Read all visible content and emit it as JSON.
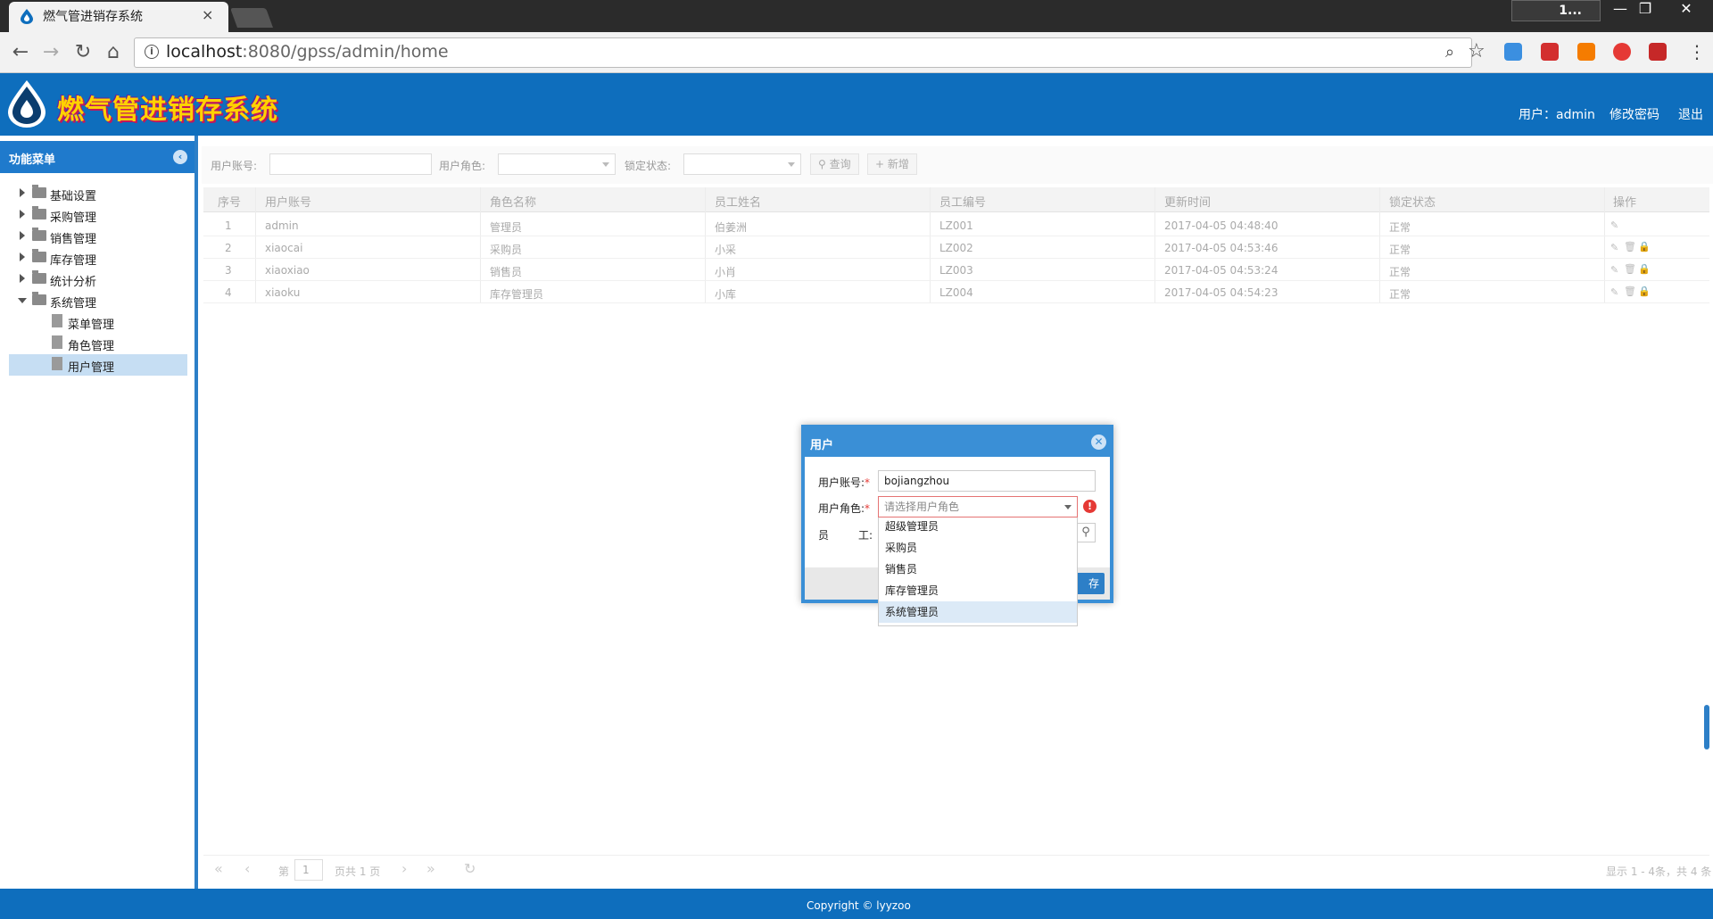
{
  "browser": {
    "tab_title": "燃气管进销存系统",
    "tab_close": "×",
    "window_user": "1...",
    "window_buttons": {
      "minimize": "—",
      "restore": "❐",
      "close": "✕"
    },
    "nav": {
      "back": "←",
      "forward": "→",
      "reload": "↻",
      "home": "⌂"
    },
    "url_host": "localhost",
    "url_path": ":8080/gpss/admin/home",
    "zoom_icon": "⌕",
    "star_icon": "☆",
    "menu_dots": "⋮",
    "extension_colors": [
      "#3b8fe0",
      "#d32f2f",
      "#f57c00",
      "#e53935",
      "#c62828"
    ]
  },
  "header": {
    "app_title": "燃气管进销存系统",
    "user_label": "用户：admin",
    "change_password": "修改密码",
    "logout": "退出"
  },
  "sidebar": {
    "title": "功能菜单",
    "collapse_icon": "‹",
    "items": [
      {
        "label": "基础设置",
        "type": "folder",
        "expanded": false
      },
      {
        "label": "采购管理",
        "type": "folder",
        "expanded": false
      },
      {
        "label": "销售管理",
        "type": "folder",
        "expanded": false
      },
      {
        "label": "库存管理",
        "type": "folder",
        "expanded": false
      },
      {
        "label": "统计分析",
        "type": "folder",
        "expanded": false
      },
      {
        "label": "系统管理",
        "type": "folder",
        "expanded": true
      },
      {
        "label": "菜单管理",
        "type": "file"
      },
      {
        "label": "角色管理",
        "type": "file"
      },
      {
        "label": "用户管理",
        "type": "file",
        "selected": true
      }
    ]
  },
  "filters": {
    "account_label": "用户账号:",
    "role_label": "用户角色:",
    "lock_label": "锁定状态:",
    "search_button": "查询",
    "add_button": "新增",
    "search_icon": "⚲",
    "add_icon": "+"
  },
  "grid": {
    "columns": [
      "序号",
      "用户账号",
      "角色名称",
      "员工姓名",
      "员工编号",
      "更新时间",
      "锁定状态",
      "操作"
    ],
    "rows": [
      {
        "no": "1",
        "account": "admin",
        "role": "管理员",
        "name": "伯姜洲",
        "emp_no": "LZ001",
        "updated": "2017-04-05 04:48:40",
        "status": "正常"
      },
      {
        "no": "2",
        "account": "xiaocai",
        "role": "采购员",
        "name": "小采",
        "emp_no": "LZ002",
        "updated": "2017-04-05 04:53:46",
        "status": "正常"
      },
      {
        "no": "3",
        "account": "xiaoxiao",
        "role": "销售员",
        "name": "小肖",
        "emp_no": "LZ003",
        "updated": "2017-04-05 04:53:24",
        "status": "正常"
      },
      {
        "no": "4",
        "account": "xiaoku",
        "role": "库存管理员",
        "name": "小库",
        "emp_no": "LZ004",
        "updated": "2017-04-05 04:54:23",
        "status": "正常"
      }
    ],
    "op_icons": {
      "edit": "✎",
      "delete": "🗑",
      "lock": "🔒"
    }
  },
  "pager": {
    "first": "«",
    "prev": "‹",
    "page_prefix": "第",
    "page_value": "1",
    "page_suffix": "页共 1 页",
    "next": "›",
    "last": "»",
    "refresh": "↻",
    "info": "显示 1 - 4条，共 4 条"
  },
  "dialog": {
    "title": "用户",
    "close_icon": "✕",
    "account_label": "用户账号:",
    "account_value": "bojiangzhou",
    "role_label": "用户角色:",
    "role_placeholder": "请选择用户角色",
    "required_mark": "*",
    "error_icon": "!",
    "employee_label_left": "员",
    "employee_label_right": "工:",
    "search_icon": "⚲",
    "save_label": "存",
    "role_options": [
      "超级管理员",
      "采购员",
      "销售员",
      "库存管理员",
      "系统管理员"
    ],
    "highlighted_option": "系统管理员"
  },
  "footer": {
    "copyright": "Copyright © lyyzoo"
  },
  "colors": {
    "brand_blue": "#0e6ebd",
    "dialog_blue": "#3a8fd6",
    "title_yellow": "#ffd200",
    "error_red": "#e53935"
  }
}
